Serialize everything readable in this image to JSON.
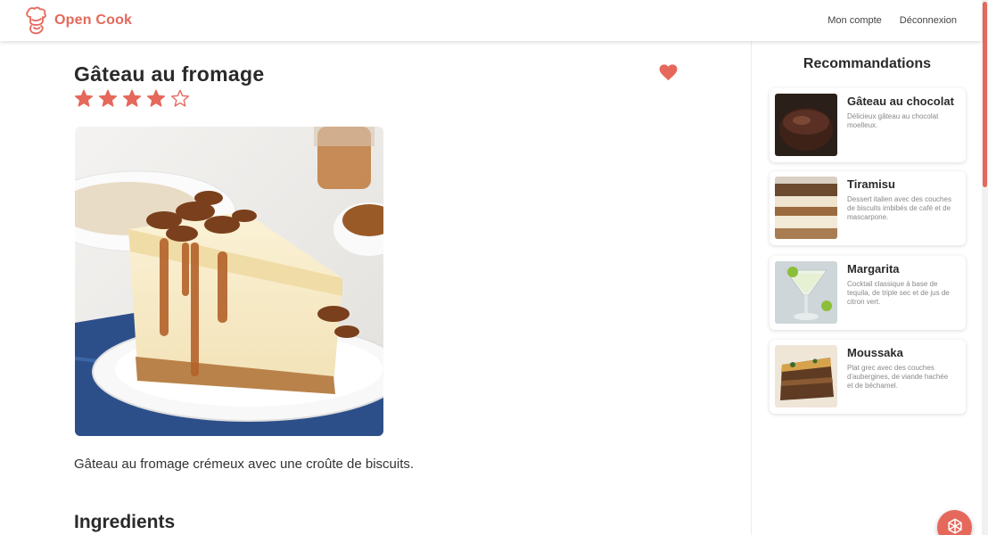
{
  "brand": {
    "name": "Open Cook",
    "color": "#e5685b",
    "logo_icon": "chef-hat-icon"
  },
  "nav": {
    "account": "Mon compte",
    "logout": "Déconnexion"
  },
  "recipe": {
    "title": "Gâteau au fromage",
    "rating": 4,
    "rating_max": 5,
    "favorite": true,
    "image": "cheesecake-photo",
    "description": "Gâteau au fromage crémeux avec une croûte de biscuits.",
    "ingredients_heading": "Ingredients"
  },
  "sidebar": {
    "title": "Recommandations",
    "items": [
      {
        "name": "Gâteau au chocolat",
        "description": "Délicieux gâteau au chocolat moelleux.",
        "image": "chocolate-cake-photo"
      },
      {
        "name": "Tiramisu",
        "description": "Dessert italien avec des couches de biscuits imbibés de café et de mascarpone.",
        "image": "tiramisu-photo"
      },
      {
        "name": "Margarita",
        "description": "Cocktail classique à base de tequila, de triple sec et de jus de citron vert.",
        "image": "margarita-photo"
      },
      {
        "name": "Moussaka",
        "description": "Plat grec avec des couches d'aubergines, de viande hachée et de béchamel.",
        "image": "moussaka-photo"
      }
    ]
  },
  "fab": {
    "icon": "openai-logo-icon"
  }
}
